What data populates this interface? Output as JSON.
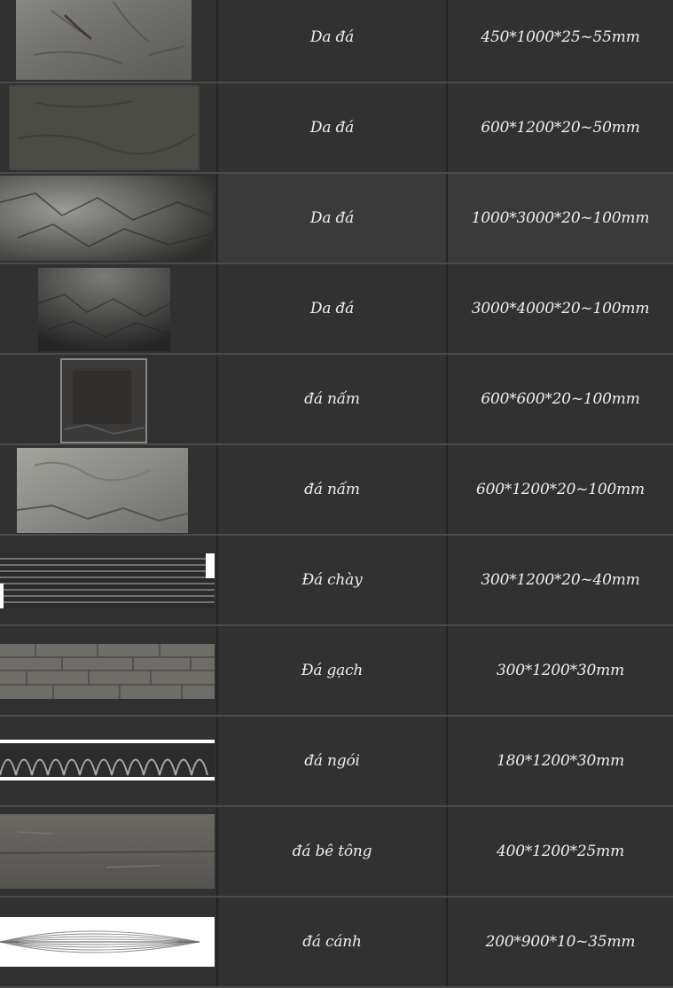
{
  "rows": [
    {
      "name": "Da đá",
      "size": "450*1000*25~55mm",
      "image": "stone-skin-tile"
    },
    {
      "name": "Da đá",
      "size": "600*1200*20~50mm",
      "image": "stone-skin-tile"
    },
    {
      "name": "Da đá",
      "size": "1000*3000*20~100mm",
      "image": "stone-skin-tile"
    },
    {
      "name": "Da đá",
      "size": "3000*4000*20~100mm",
      "image": "stone-skin-tile"
    },
    {
      "name": "đá nấm",
      "size": "600*600*20~100mm",
      "image": "mushroom-stone-tile"
    },
    {
      "name": "đá nấm",
      "size": "600*1200*20~100mm",
      "image": "mushroom-stone-tile"
    },
    {
      "name": "Đá chày",
      "size": "300*1200*20~40mm",
      "image": "striped-stone-tile"
    },
    {
      "name": "Đá gạch",
      "size": "300*1200*30mm",
      "image": "brick-stone-tile"
    },
    {
      "name": "đá ngói",
      "size": "180*1200*30mm",
      "image": "roof-tile-stone"
    },
    {
      "name": "đá bê tông",
      "size": "400*1200*25mm",
      "image": "concrete-stone-tile"
    },
    {
      "name": "đá cánh",
      "size": "200*900*10~35mm",
      "image": "wing-stone-tile"
    }
  ],
  "colors": {
    "background": "#313131",
    "highlight": "#3a3a3a",
    "text": "#eeeeee",
    "divider": "#4a4a4a"
  }
}
